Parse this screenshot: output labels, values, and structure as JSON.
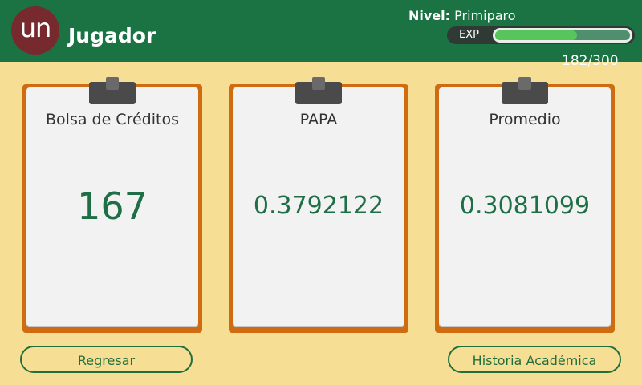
{
  "header": {
    "logo_text": "un",
    "title": "Jugador",
    "nivel_label": "Nivel:",
    "nivel_value": "Primiparo",
    "exp_label": "EXP",
    "exp_count": "182/300",
    "exp_fraction": 0.607
  },
  "cards": [
    {
      "label": "Bolsa de Créditos",
      "value": "167"
    },
    {
      "label": "PAPA",
      "value": "0.3792122"
    },
    {
      "label": "Promedio",
      "value": "0.3081099"
    }
  ],
  "buttons": {
    "back_label": "Regresar",
    "history_label": "Historia Académica"
  },
  "colors": {
    "header": "#1b7344",
    "background": "#f6df94",
    "card_border": "#cf6c12",
    "value_text": "#1e6e46",
    "exp_fill": "#58c55c"
  }
}
